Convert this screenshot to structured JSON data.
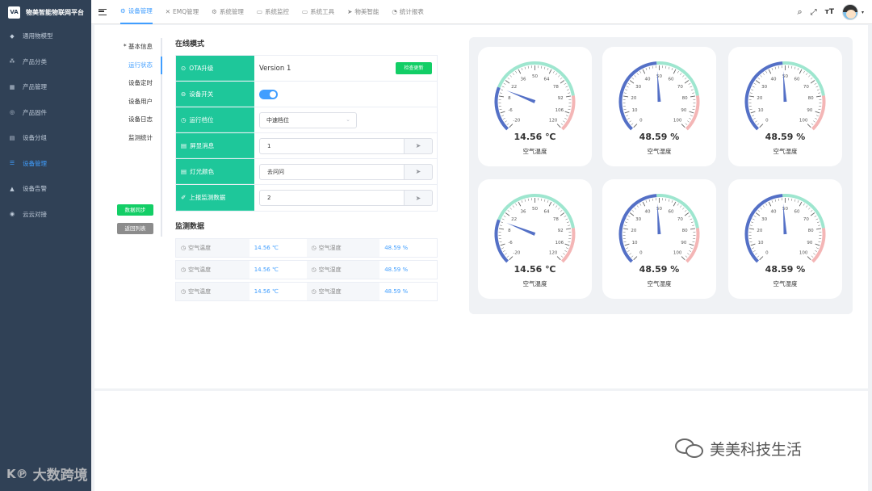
{
  "app": {
    "logo_text": "VA",
    "title": "物美智能物联网平台"
  },
  "sidebar": {
    "items": [
      {
        "label": "通用物模型",
        "icon": "cube-icon",
        "glyph": "◆"
      },
      {
        "label": "产品分类",
        "icon": "tree-icon",
        "glyph": "⁂"
      },
      {
        "label": "产品管理",
        "icon": "grid-icon",
        "glyph": "▦"
      },
      {
        "label": "产品固件",
        "icon": "chip-icon",
        "glyph": "◎"
      },
      {
        "label": "设备分组",
        "icon": "table-icon",
        "glyph": "▤"
      },
      {
        "label": "设备管理",
        "icon": "list-icon",
        "glyph": "☰"
      },
      {
        "label": "设备告警",
        "icon": "bell-icon",
        "glyph": "▲"
      },
      {
        "label": "云云对接",
        "icon": "cloud-icon",
        "glyph": "◉"
      }
    ]
  },
  "topnav": {
    "items": [
      {
        "label": "设备管理",
        "glyph": "⚙"
      },
      {
        "label": "EMQ管理",
        "glyph": "✕"
      },
      {
        "label": "系统管理",
        "glyph": "⚙"
      },
      {
        "label": "系统监控",
        "glyph": "▭"
      },
      {
        "label": "系统工具",
        "glyph": "▭"
      },
      {
        "label": "物美智能",
        "glyph": "➤"
      },
      {
        "label": "统计报表",
        "glyph": "◔"
      }
    ],
    "right_icons": [
      "search-icon",
      "fullscreen-icon",
      "font-size-icon",
      "avatar"
    ]
  },
  "subnav": {
    "items": [
      "基本信息",
      "运行状态",
      "设备定时",
      "设备用户",
      "设备日志",
      "监测统计"
    ],
    "required_mark": "* ",
    "sync_button": "数据同步",
    "back_button": "返回列表"
  },
  "run": {
    "section_title": "在线模式",
    "ota_label": "OTA升级",
    "ota_version": "Version 1",
    "ota_check_button": "检查更新",
    "switch_label": "设备开关",
    "gear_label": "运行档位",
    "gear_value": "中速档位",
    "screen_label": "屏显消息",
    "screen_value": "1",
    "light_label": "灯光颜色",
    "light_value": "去问问",
    "report_label": "上报监测数据",
    "report_value": "2"
  },
  "monitor": {
    "section_title": "监测数据",
    "rows": [
      {
        "k1": "空气温度",
        "v1": "14.56 ℃",
        "k2": "空气湿度",
        "v2": "48.59 %"
      },
      {
        "k1": "空气温度",
        "v1": "14.56 ℃",
        "k2": "空气湿度",
        "v2": "48.59 %"
      },
      {
        "k1": "空气温度",
        "v1": "14.56 ℃",
        "k2": "空气湿度",
        "v2": "48.59 %"
      }
    ]
  },
  "gauges": [
    {
      "value": 14.56,
      "display": "14.56 ℃",
      "label": "空气温度",
      "min": -20,
      "max": 120,
      "ticks": [
        "-20",
        "-6",
        "8",
        "22",
        "36",
        "50",
        "64",
        "78",
        "92",
        "106",
        "120"
      ]
    },
    {
      "value": 48.59,
      "display": "48.59 %",
      "label": "空气湿度",
      "min": 0,
      "max": 100,
      "ticks": [
        "0",
        "10",
        "20",
        "30",
        "40",
        "50",
        "60",
        "70",
        "80",
        "90",
        "100"
      ]
    },
    {
      "value": 48.59,
      "display": "48.59 %",
      "label": "空气湿度",
      "min": 0,
      "max": 100,
      "ticks": [
        "0",
        "10",
        "20",
        "30",
        "40",
        "50",
        "60",
        "70",
        "80",
        "90",
        "100"
      ]
    },
    {
      "value": 14.56,
      "display": "14.56 ℃",
      "label": "空气温度",
      "min": -20,
      "max": 120,
      "ticks": [
        "-20",
        "-6",
        "8",
        "22",
        "36",
        "50",
        "64",
        "78",
        "92",
        "106",
        "120"
      ]
    },
    {
      "value": 48.59,
      "display": "48.59 %",
      "label": "空气湿度",
      "min": 0,
      "max": 100,
      "ticks": [
        "0",
        "10",
        "20",
        "30",
        "40",
        "50",
        "60",
        "70",
        "80",
        "90",
        "100"
      ]
    },
    {
      "value": 48.59,
      "display": "48.59 %",
      "label": "空气湿度",
      "min": 0,
      "max": 100,
      "ticks": [
        "0",
        "10",
        "20",
        "30",
        "40",
        "50",
        "60",
        "70",
        "80",
        "90",
        "100"
      ]
    }
  ],
  "watermarks": {
    "left": "大数跨境",
    "right": "美美科技生活"
  },
  "colors": {
    "sidebar": "#304156",
    "accent": "#409eff",
    "run_label": "#1ec79a",
    "button_green": "#13ce66",
    "gauge_blue": "#5470c6",
    "gauge_green": "#9ee6cf",
    "gauge_red": "#f4b6b6"
  }
}
